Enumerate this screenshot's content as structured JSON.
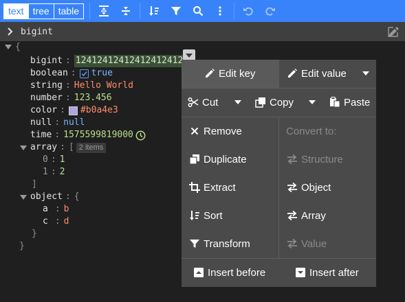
{
  "colors": {
    "accent": "#3883fa",
    "string": "#ff8c6b",
    "number": "#b8e08a",
    "keyword": "#7db5ff",
    "swatch": "#b0a4e3"
  },
  "toolbar": {
    "modes": [
      {
        "label": "text",
        "active": true
      },
      {
        "label": "tree",
        "active": false
      },
      {
        "label": "table",
        "active": false
      }
    ],
    "icons": [
      "expand-all-icon",
      "collapse-all-icon",
      "sort-icon",
      "filter-icon",
      "search-icon",
      "more-icon",
      "undo-icon",
      "redo-icon"
    ]
  },
  "navbar": {
    "path": "bigint"
  },
  "tree": {
    "open_brace": "{",
    "close_brace": "}",
    "colon": ":",
    "rows": {
      "bigint": {
        "key": "bigint",
        "value": "124124124124124124124"
      },
      "boolean": {
        "key": "boolean",
        "value": "true"
      },
      "string": {
        "key": "string",
        "value": "Hello World"
      },
      "number": {
        "key": "number",
        "value": "123.456"
      },
      "color": {
        "key": "color",
        "value": "#b0a4e3"
      },
      "null": {
        "key": "null",
        "value": "null"
      },
      "time": {
        "key": "time",
        "value": "1575599819000"
      },
      "array": {
        "key": "array",
        "open": "[",
        "badge": "2 items",
        "close": "]",
        "items": [
          {
            "index": "0",
            "value": "1"
          },
          {
            "index": "1",
            "value": "2"
          }
        ]
      },
      "object": {
        "key": "object",
        "open": "{",
        "close": "}",
        "items": [
          {
            "key": "a",
            "value": "b"
          },
          {
            "key": "c",
            "value": "d"
          }
        ]
      }
    }
  },
  "menu": {
    "edit_key": "Edit key",
    "edit_value": "Edit value",
    "cut": "Cut",
    "copy": "Copy",
    "paste": "Paste",
    "remove": "Remove",
    "duplicate": "Duplicate",
    "extract": "Extract",
    "sort": "Sort",
    "transform": "Transform",
    "convert_to": "Convert to:",
    "structure": "Structure",
    "object": "Object",
    "array": "Array",
    "value": "Value",
    "insert_before": "Insert before",
    "insert_after": "Insert after"
  }
}
